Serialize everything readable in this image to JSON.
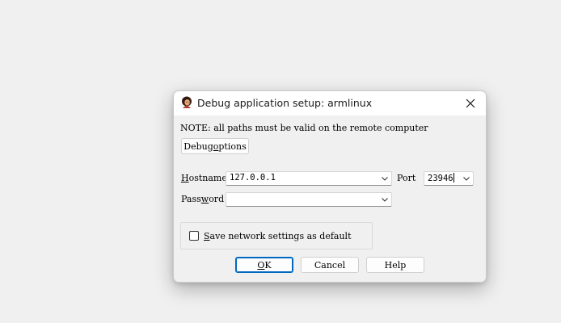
{
  "window": {
    "title": "Debug application setup: armlinux",
    "app_icon": "ida-debugger-portrait-icon"
  },
  "note": "NOTE: all paths must be valid on the remote computer",
  "buttons": {
    "debug_options": {
      "pre": "Debug ",
      "mnemonic": "o",
      "post": "ptions"
    },
    "ok": {
      "pre": "",
      "mnemonic": "O",
      "post": "K"
    },
    "cancel": "Cancel",
    "help": "Help"
  },
  "fields": {
    "hostname": {
      "label_pre": "",
      "label_mnemonic": "H",
      "label_post": "ostname",
      "value": "127.0.0.1"
    },
    "port": {
      "label": "Port",
      "value": "23946"
    },
    "password": {
      "label_pre": "Pass",
      "label_mnemonic": "w",
      "label_post": "ord",
      "value": ""
    }
  },
  "save_default": {
    "label_pre": "",
    "label_mnemonic": "S",
    "label_post": "ave network settings as default",
    "checked": false
  },
  "colors": {
    "accent": "#0067c0",
    "dialog_bg": "#f0f0f0",
    "titlebar_bg": "#ffffff"
  }
}
